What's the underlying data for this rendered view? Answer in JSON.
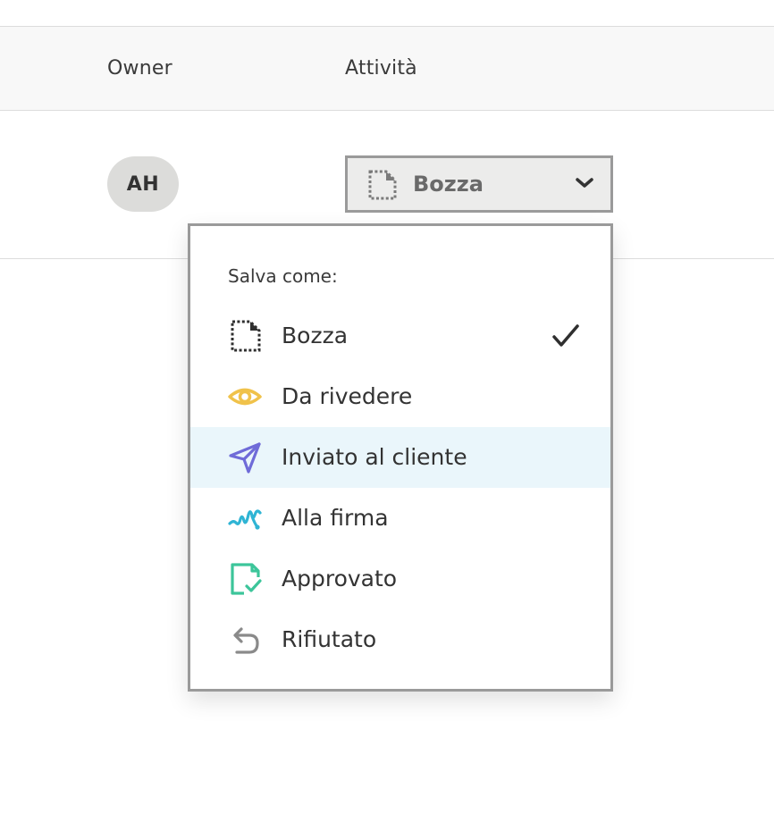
{
  "table": {
    "headers": {
      "owner": "Owner",
      "activity": "Attività"
    },
    "row": {
      "owner_initials": "AH",
      "status_selected": "Bozza"
    }
  },
  "dropdown": {
    "heading": "Salva come:",
    "selected": "Bozza",
    "highlighted": "Inviato al cliente",
    "items": [
      {
        "label": "Bozza",
        "icon": "draft-document-icon",
        "color": "#2f2f2f",
        "checked": true
      },
      {
        "label": "Da rivedere",
        "icon": "eye-icon",
        "color": "#f0c24a",
        "checked": false
      },
      {
        "label": "Inviato al cliente",
        "icon": "paper-plane-icon",
        "color": "#6f6bd8",
        "checked": false
      },
      {
        "label": "Alla firma",
        "icon": "signature-icon",
        "color": "#2fb4d4",
        "checked": false
      },
      {
        "label": "Approvato",
        "icon": "approved-document-icon",
        "color": "#3cc59a",
        "checked": false
      },
      {
        "label": "Rifiutato",
        "icon": "undo-arrow-icon",
        "color": "#8a8a8a",
        "checked": false
      }
    ]
  },
  "colors": {
    "highlight_bg": "#eaf6fb",
    "border": "#9a9a9a",
    "header_bg": "#f8f8f8"
  }
}
